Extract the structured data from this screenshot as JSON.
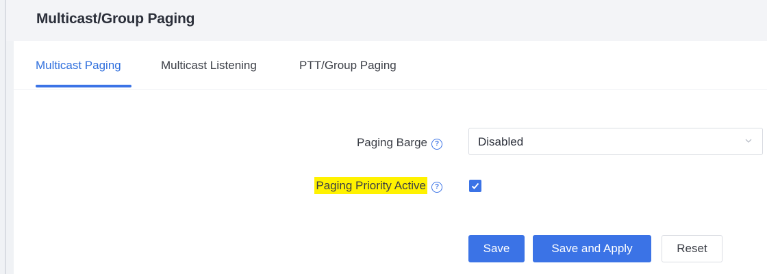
{
  "header": {
    "title": "Multicast/Group Paging"
  },
  "tabs": [
    {
      "label": "Multicast Paging",
      "active": true
    },
    {
      "label": "Multicast Listening",
      "active": false
    },
    {
      "label": "PTT/Group Paging",
      "active": false
    }
  ],
  "form": {
    "paging_barge": {
      "label": "Paging Barge",
      "value": "Disabled"
    },
    "paging_priority_active": {
      "label": "Paging Priority Active",
      "checked": true
    }
  },
  "buttons": {
    "save": "Save",
    "save_apply": "Save and Apply",
    "reset": "Reset"
  },
  "colors": {
    "accent": "#3b73e6",
    "highlight": "#fff200"
  },
  "icons": {
    "help": "help-circle-icon",
    "dropdown": "chevron-down-icon",
    "check": "check-icon"
  }
}
